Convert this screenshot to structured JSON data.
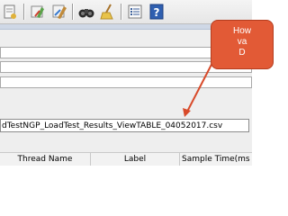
{
  "toolbar": {
    "icons": [
      "clear-icon",
      "clear-all-icon",
      "search-binoculars-icon",
      "broom-icon",
      "function-list-icon",
      "help-icon"
    ],
    "help_label": "?"
  },
  "results": {
    "filename_value": "dTestNGP_LoadTest_Results_ViewTABLE_04052017.csv"
  },
  "table": {
    "columns": [
      "Thread Name",
      "Label",
      "Sample Time(ms"
    ]
  },
  "callout": {
    "lines": [
      "How",
      "va",
      "D"
    ],
    "color": "#e25a36"
  }
}
